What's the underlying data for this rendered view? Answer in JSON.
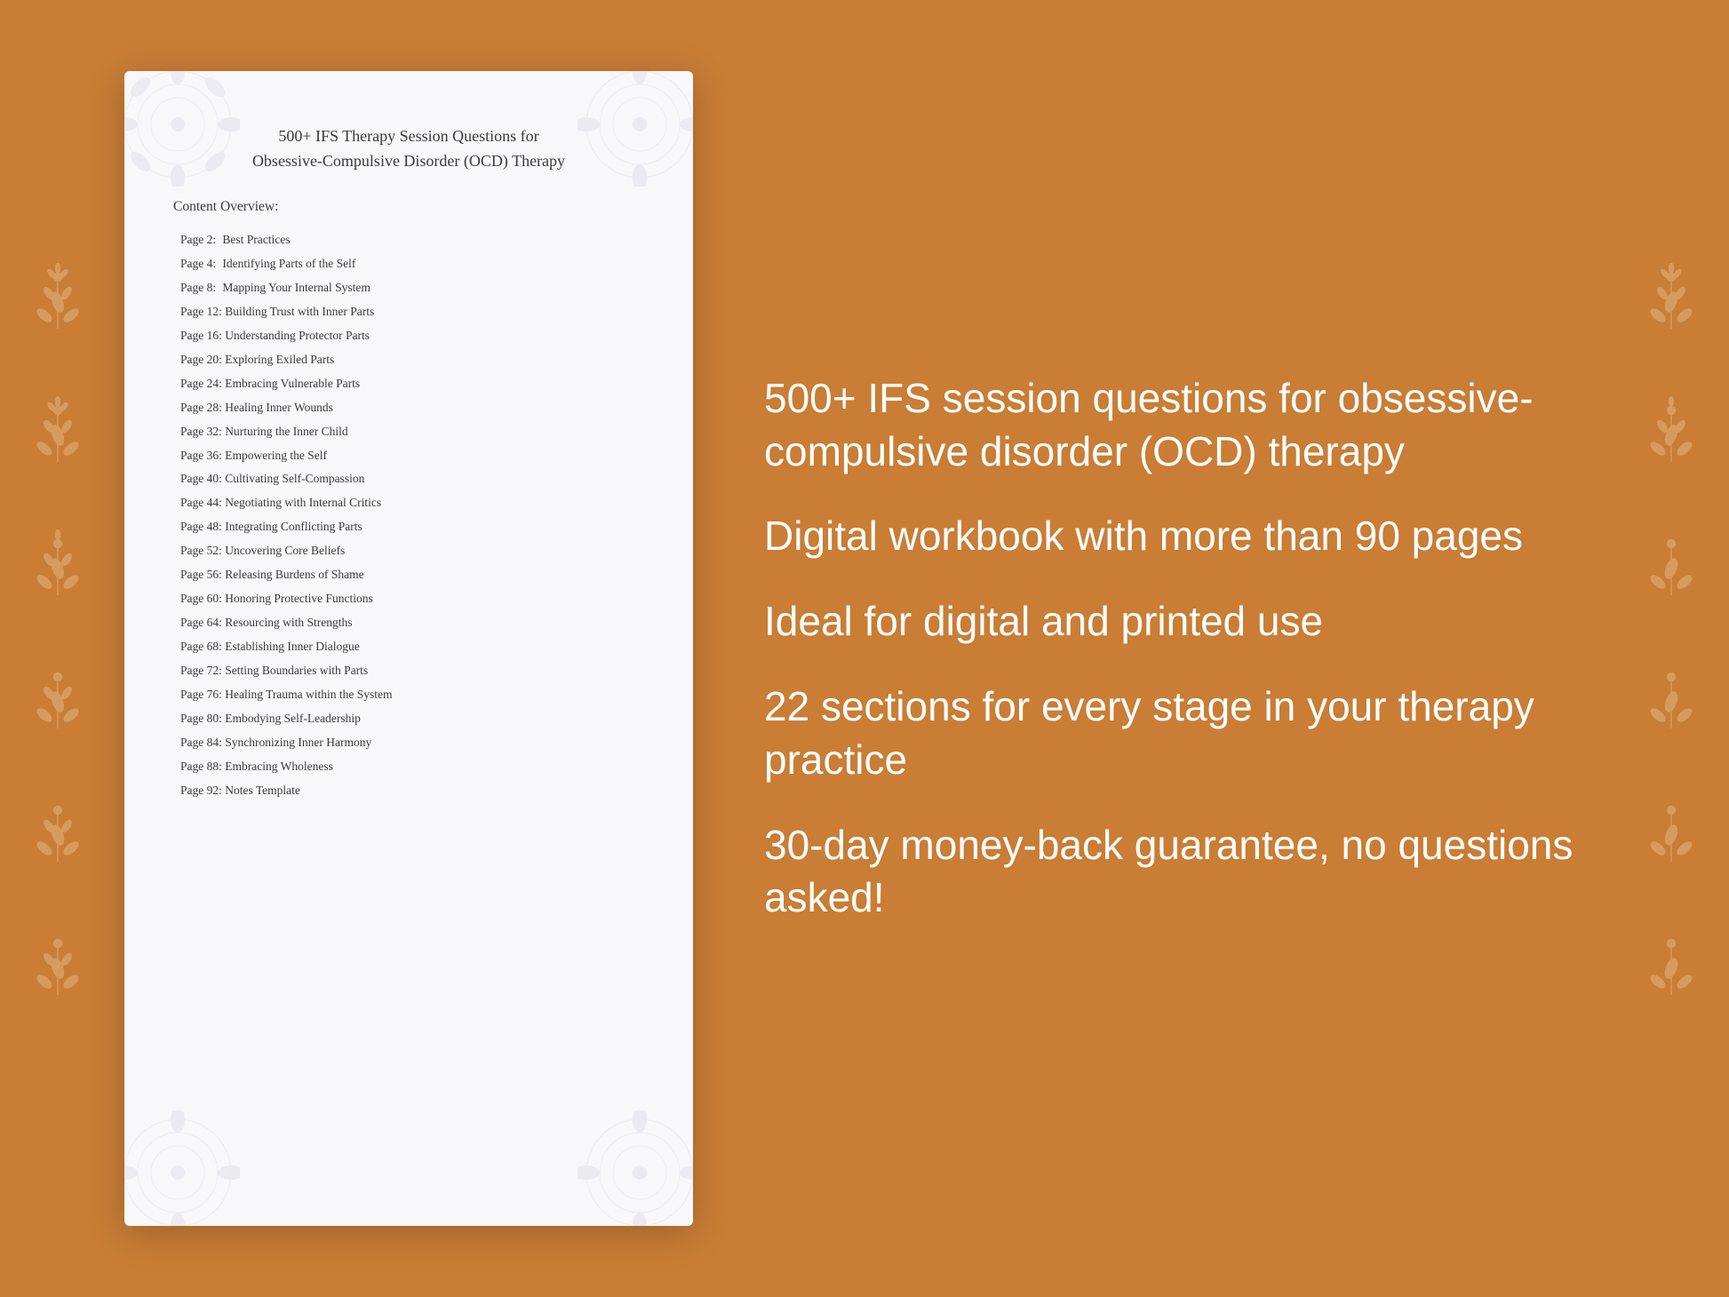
{
  "background_color": "#C97D35",
  "document": {
    "title_line1": "500+ IFS Therapy Session Questions for",
    "title_line2": "Obsessive-Compulsive Disorder (OCD) Therapy",
    "content_overview_label": "Content Overview:",
    "toc_items": [
      {
        "page": "Page  2:",
        "title": "Best Practices"
      },
      {
        "page": "Page  4:",
        "title": "Identifying Parts of the Self"
      },
      {
        "page": "Page  8:",
        "title": "Mapping Your Internal System"
      },
      {
        "page": "Page 12:",
        "title": "Building Trust with Inner Parts"
      },
      {
        "page": "Page 16:",
        "title": "Understanding Protector Parts"
      },
      {
        "page": "Page 20:",
        "title": "Exploring Exiled Parts"
      },
      {
        "page": "Page 24:",
        "title": "Embracing Vulnerable Parts"
      },
      {
        "page": "Page 28:",
        "title": "Healing Inner Wounds"
      },
      {
        "page": "Page 32:",
        "title": "Nurturing the Inner Child"
      },
      {
        "page": "Page 36:",
        "title": "Empowering the Self"
      },
      {
        "page": "Page 40:",
        "title": "Cultivating Self-Compassion"
      },
      {
        "page": "Page 44:",
        "title": "Negotiating with Internal Critics"
      },
      {
        "page": "Page 48:",
        "title": "Integrating Conflicting Parts"
      },
      {
        "page": "Page 52:",
        "title": "Uncovering Core Beliefs"
      },
      {
        "page": "Page 56:",
        "title": "Releasing Burdens of Shame"
      },
      {
        "page": "Page 60:",
        "title": "Honoring Protective Functions"
      },
      {
        "page": "Page 64:",
        "title": "Resourcing with Strengths"
      },
      {
        "page": "Page 68:",
        "title": "Establishing Inner Dialogue"
      },
      {
        "page": "Page 72:",
        "title": "Setting Boundaries with Parts"
      },
      {
        "page": "Page 76:",
        "title": "Healing Trauma within the System"
      },
      {
        "page": "Page 80:",
        "title": "Embodying Self-Leadership"
      },
      {
        "page": "Page 84:",
        "title": "Synchronizing Inner Harmony"
      },
      {
        "page": "Page 88:",
        "title": "Embracing Wholeness"
      },
      {
        "page": "Page 92:",
        "title": "Notes Template"
      }
    ]
  },
  "features": [
    {
      "id": "feature1",
      "text": "500+ IFS session questions for obsessive-compulsive disorder (OCD) therapy"
    },
    {
      "id": "feature2",
      "text": "Digital workbook with more than 90 pages"
    },
    {
      "id": "feature3",
      "text": "Ideal for digital and printed use"
    },
    {
      "id": "feature4",
      "text": "22 sections for every stage in your therapy practice"
    },
    {
      "id": "feature5",
      "text": "30-day money-back guarantee, no questions asked!"
    }
  ]
}
